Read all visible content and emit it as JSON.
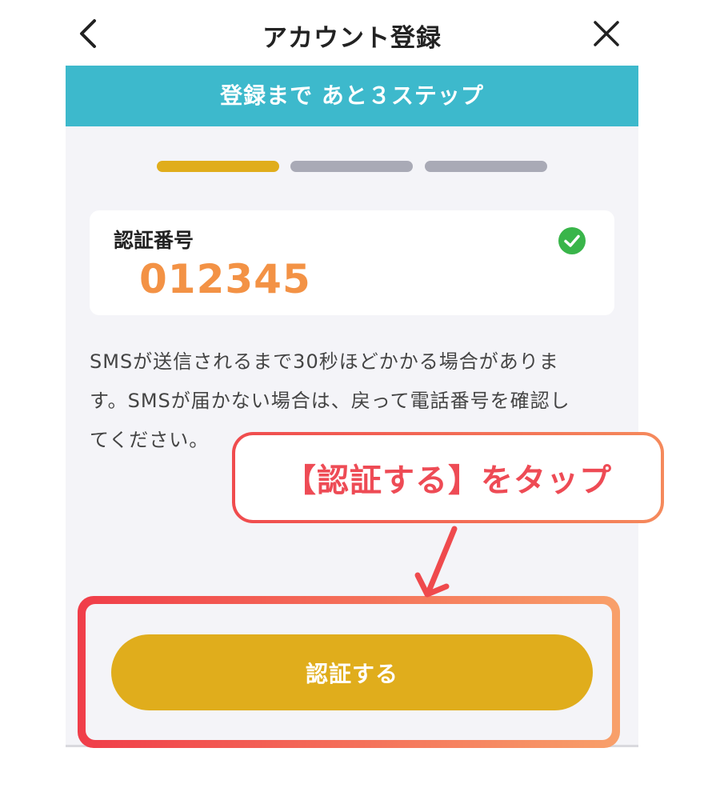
{
  "header": {
    "title": "アカウント登録"
  },
  "banner": {
    "text": "登録まで あと３ステップ"
  },
  "progress": {
    "steps_total": 3,
    "steps_done": 1
  },
  "code_card": {
    "label": "認証番号",
    "value": "012345",
    "verified": true
  },
  "info": {
    "lines": [
      "SMSが送信されるまで30秒ほどかかる場合がありま",
      "す。SMSが届かない場合は、戻って電話番号を確認し",
      "てください。"
    ]
  },
  "callout": {
    "text": "【認証する】をタップ"
  },
  "action": {
    "verify_label": "認証する"
  },
  "icons": {
    "back": "chevron-left-icon",
    "close": "close-icon",
    "check": "check-circle-icon",
    "arrow": "arrow-down-icon"
  },
  "colors": {
    "banner": "#3db9cc",
    "progress_active": "#e0ad1c",
    "progress_inactive": "#a9aab6",
    "code_value": "#f39245",
    "check": "#39b54a",
    "button": "#e0ad1c",
    "callout_text": "#ee4b55",
    "annotation": "#ef4a4d"
  }
}
